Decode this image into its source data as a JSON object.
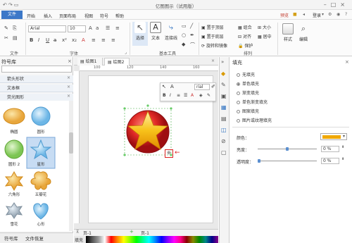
{
  "window": {
    "title": "亿图图示（试用版）"
  },
  "menu": {
    "file": "文件",
    "items": [
      "开始",
      "插入",
      "页面布局",
      "视图",
      "符号",
      "帮助"
    ]
  },
  "topright": {
    "preview": "预览",
    "login": "登录",
    "login_caret": "▾"
  },
  "ribbon": {
    "font_name": "Arial",
    "font_size": "10",
    "groups": {
      "file": "文件",
      "font": "字体",
      "tools": "基本工具",
      "arrange": "排列"
    },
    "tools": {
      "select": "选择",
      "text": "文本",
      "connector": "连接线"
    },
    "arrange_items": [
      "置于顶层",
      "置于底层",
      "旋转和镜像",
      "组合",
      "对齐",
      "保护",
      "大小",
      "居中"
    ],
    "style": "样式",
    "edit": "编辑"
  },
  "left_panel": {
    "title": "符号库",
    "categories": [
      "箭头形状",
      "文本框",
      "荧光图形"
    ],
    "shapes": [
      "椭圆",
      "圆形",
      "圆形 2",
      "星形",
      "六角形",
      "五瓣花",
      "雪花",
      "心形"
    ],
    "bottom_tabs": [
      "符号库",
      "文件恢复"
    ]
  },
  "canvas": {
    "tabs": [
      "绘图1",
      "绘图2"
    ],
    "ruler_marks": [
      "100",
      "120",
      "140",
      "160"
    ],
    "page_tab": "页-1",
    "page_tab2": "页-1",
    "fill_label": "填充"
  },
  "right_panel": {
    "title": "填充",
    "options": [
      "无填充",
      "单色填充",
      "渐变填充",
      "单色渐变填充",
      "图案填充",
      "图片或纹理填充"
    ],
    "selected_index": 1,
    "color_label": "颜色：",
    "brightness_label": "亮度：",
    "transparency_label": "透明度：",
    "brightness_value": "0 %",
    "transparency_value": "0 %",
    "fill_color": "#f0a800"
  },
  "minitoolbar": {
    "font": "rial"
  },
  "colors": {
    "accent": "#3c78c8",
    "star": "#f7b500",
    "circle": "#d9262a"
  }
}
